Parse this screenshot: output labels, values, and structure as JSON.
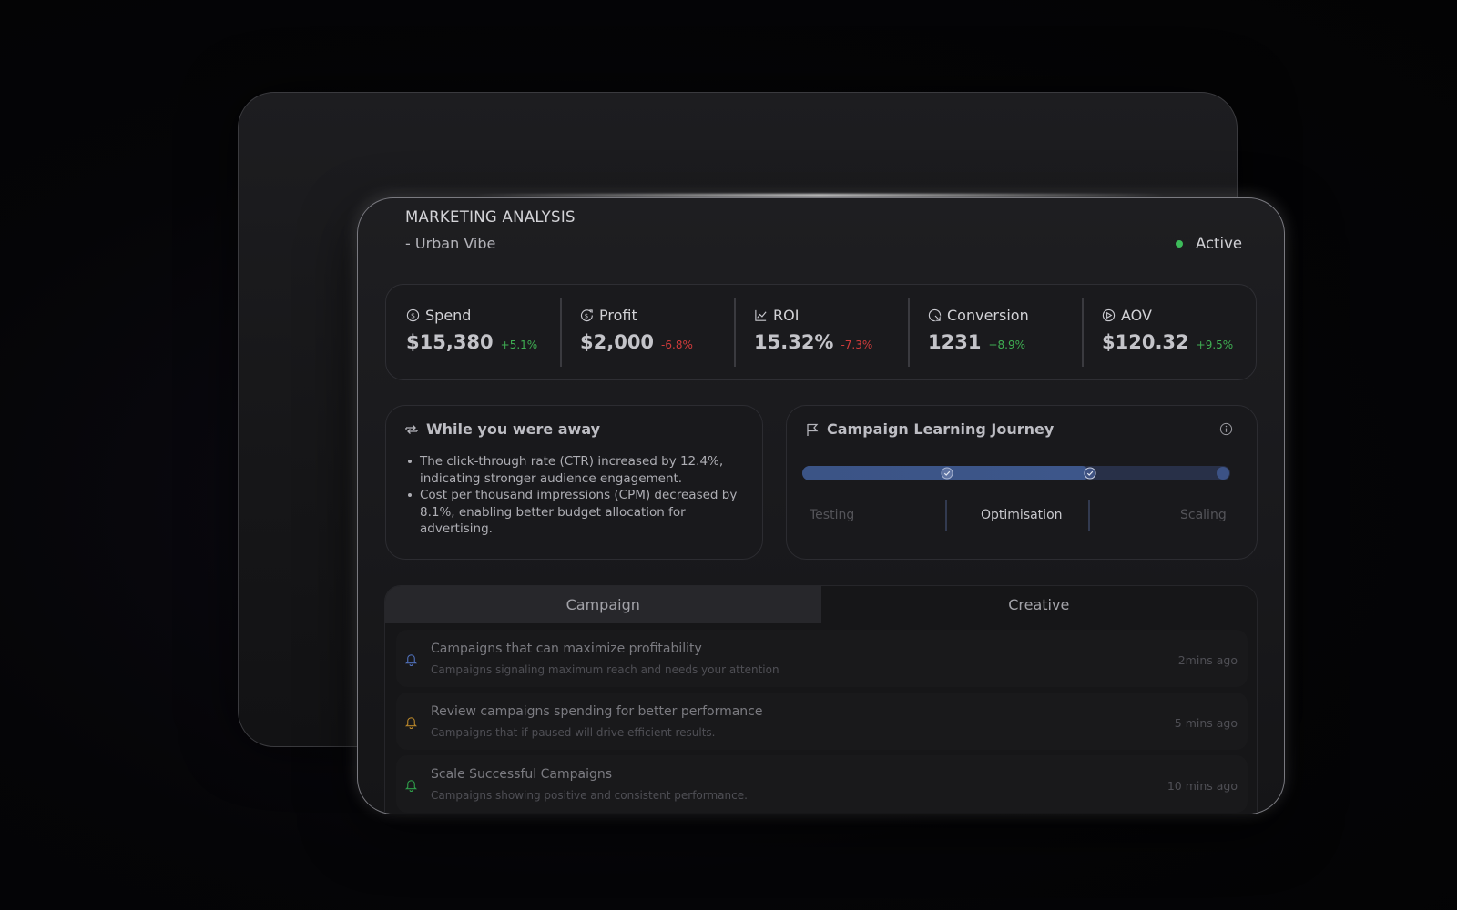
{
  "header": {
    "title": "MARKETING ANALYSIS",
    "subtitle": "- Urban Vibe",
    "status": "Active",
    "status_color": "#3dbb5a"
  },
  "stats": [
    {
      "icon": "dollar-icon",
      "label": "Spend",
      "value": "$15,380",
      "delta": "+5.1%",
      "trend": "up"
    },
    {
      "icon": "profit-icon",
      "label": "Profit",
      "value": "$2,000",
      "delta": "-6.8%",
      "trend": "down"
    },
    {
      "icon": "line-chart-icon",
      "label": "ROI",
      "value": "15.32%",
      "delta": "-7.3%",
      "trend": "down"
    },
    {
      "icon": "conversion-icon",
      "label": "Conversion",
      "value": "1231",
      "delta": "+8.9%",
      "trend": "up"
    },
    {
      "icon": "aov-icon",
      "label": "AOV",
      "value": "$120.32",
      "delta": "+9.5%",
      "trend": "up"
    }
  ],
  "away": {
    "icon": "repeat-icon",
    "title": "While you were away",
    "items": [
      "The click-through rate (CTR) increased by 12.4%, indicating stronger audience engagement.",
      "Cost per thousand impressions (CPM) decreased by 8.1%, enabling better budget allocation for advertising."
    ]
  },
  "journey": {
    "icon": "flag-icon",
    "title": "Campaign Learning Journey",
    "stages": [
      "Testing",
      "Optimisation",
      "Scaling"
    ],
    "current_stage": "Optimisation",
    "progress": 0.67
  },
  "tabs": {
    "active": "Campaign",
    "items": [
      "Campaign",
      "Creative"
    ]
  },
  "notifications": [
    {
      "icon": "bell-icon",
      "icon_color": "#4f6fb8",
      "title": "Campaigns that can maximize profitability",
      "subtitle": "Campaigns signaling maximum reach and needs your attention",
      "time": "2mins ago"
    },
    {
      "icon": "bell-icon",
      "icon_color": "#b8862a",
      "title": "Review campaigns spending for better performance",
      "subtitle": "Campaigns that if paused will drive efficient results.",
      "time": "5 mins ago"
    },
    {
      "icon": "bell-icon",
      "icon_color": "#2f9e4a",
      "title": "Scale Successful Campaigns",
      "subtitle": "Campaigns showing positive and consistent performance.",
      "time": "10 mins ago"
    }
  ]
}
